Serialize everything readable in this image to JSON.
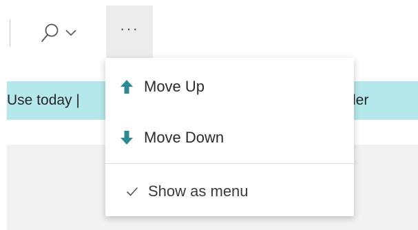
{
  "toolbar": {
    "search_icon": "search-icon",
    "chevron_icon": "chevron-down-icon",
    "more_label": "···"
  },
  "list": {
    "row_left_text": "Use today |",
    "row_right_text": "der"
  },
  "menu": {
    "items": [
      {
        "label": "Move Up",
        "icon": "arrow-up-icon"
      },
      {
        "label": "Move Down",
        "icon": "arrow-down-icon"
      },
      {
        "label": "Show as menu",
        "icon": "checkmark-icon",
        "checked": true
      }
    ]
  },
  "colors": {
    "accent_teal": "#2b8a94",
    "row_highlight": "#b5e8eb",
    "button_active_bg": "#ececec"
  }
}
